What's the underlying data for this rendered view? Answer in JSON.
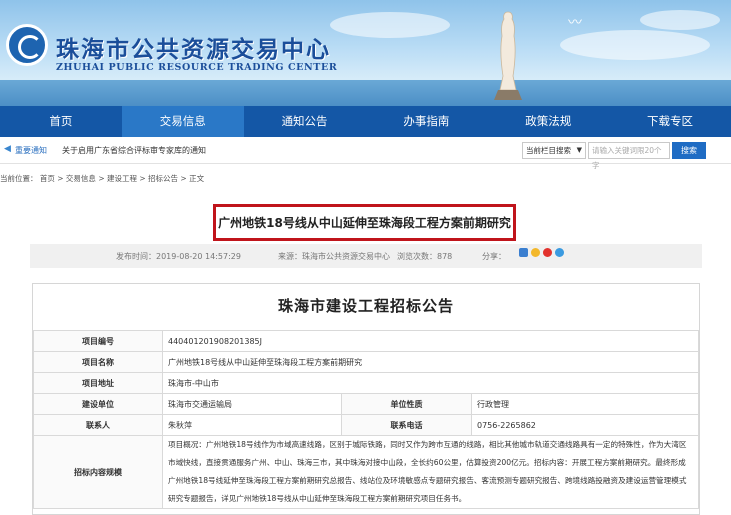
{
  "header": {
    "title": "珠海市公共资源交易中心",
    "subtitle": "ZHUHAI PUBLIC RESOURCE TRADING CENTER"
  },
  "nav": {
    "items": [
      {
        "label": "首页"
      },
      {
        "label": "交易信息"
      },
      {
        "label": "通知公告"
      },
      {
        "label": "办事指南"
      },
      {
        "label": "政策法规"
      },
      {
        "label": "下载专区"
      }
    ],
    "active_index": 1
  },
  "notice_bar": {
    "label": "重要通知",
    "text": "关于启用广东省综合评标审专家库的通知"
  },
  "search": {
    "scope": "当前栏目搜索",
    "placeholder": "请输入关键词限20个字",
    "button": "搜索"
  },
  "breadcrumb": "当前位置： 首页 > 交易信息 > 建设工程 > 招标公告 > 正文",
  "article": {
    "title": "广州地铁18号线从中山延伸至珠海段工程方案前期研究",
    "publish_time": "发布时间：2019-08-20 14:57:29",
    "source": "来源：珠海市公共资源交易中心",
    "views": "浏览次数：878",
    "share_label": "分享："
  },
  "notice": {
    "heading": "珠海市建设工程招标公告",
    "rows": [
      {
        "key": "项目编号",
        "value": "440401201908201385J"
      },
      {
        "key": "项目名称",
        "value": "广州地铁18号线从中山延伸至珠海段工程方案前期研究"
      },
      {
        "key": "项目地址",
        "value": "珠海市-中山市"
      }
    ],
    "owner_key": "建设单位",
    "owner_value": "珠海市交通运输局",
    "nature_key": "单位性质",
    "nature_value": "行政管理",
    "contact_key": "联系人",
    "contact_value": "朱秋萍",
    "phone_key": "联系电话",
    "phone_value": "0756-2265862",
    "scope_key": "招标内容规模",
    "scope_value": "项目概况：广州地铁18号线作为市域高速线路，区别于城际铁路，同时又作为跨市互通的线路，相比其他城市轨道交通线路具有一定的特殊性，作为大湾区市域快线，直接贯通服务广州、中山、珠海三市，其中珠海对接中山段，全长约60公里，估算投资200亿元。招标内容：开展工程方案前期研究。最终形成广州地铁18号线延伸至珠海段工程方案前期研究总报告、线站位及环境敏感点专题研究报告、客流预测专题研究报告、跨境线路投融资及建设运营管理模式研究专题报告，详见广州地铁18号线从中山延伸至珠海段工程方案前期研究项目任务书。"
  }
}
